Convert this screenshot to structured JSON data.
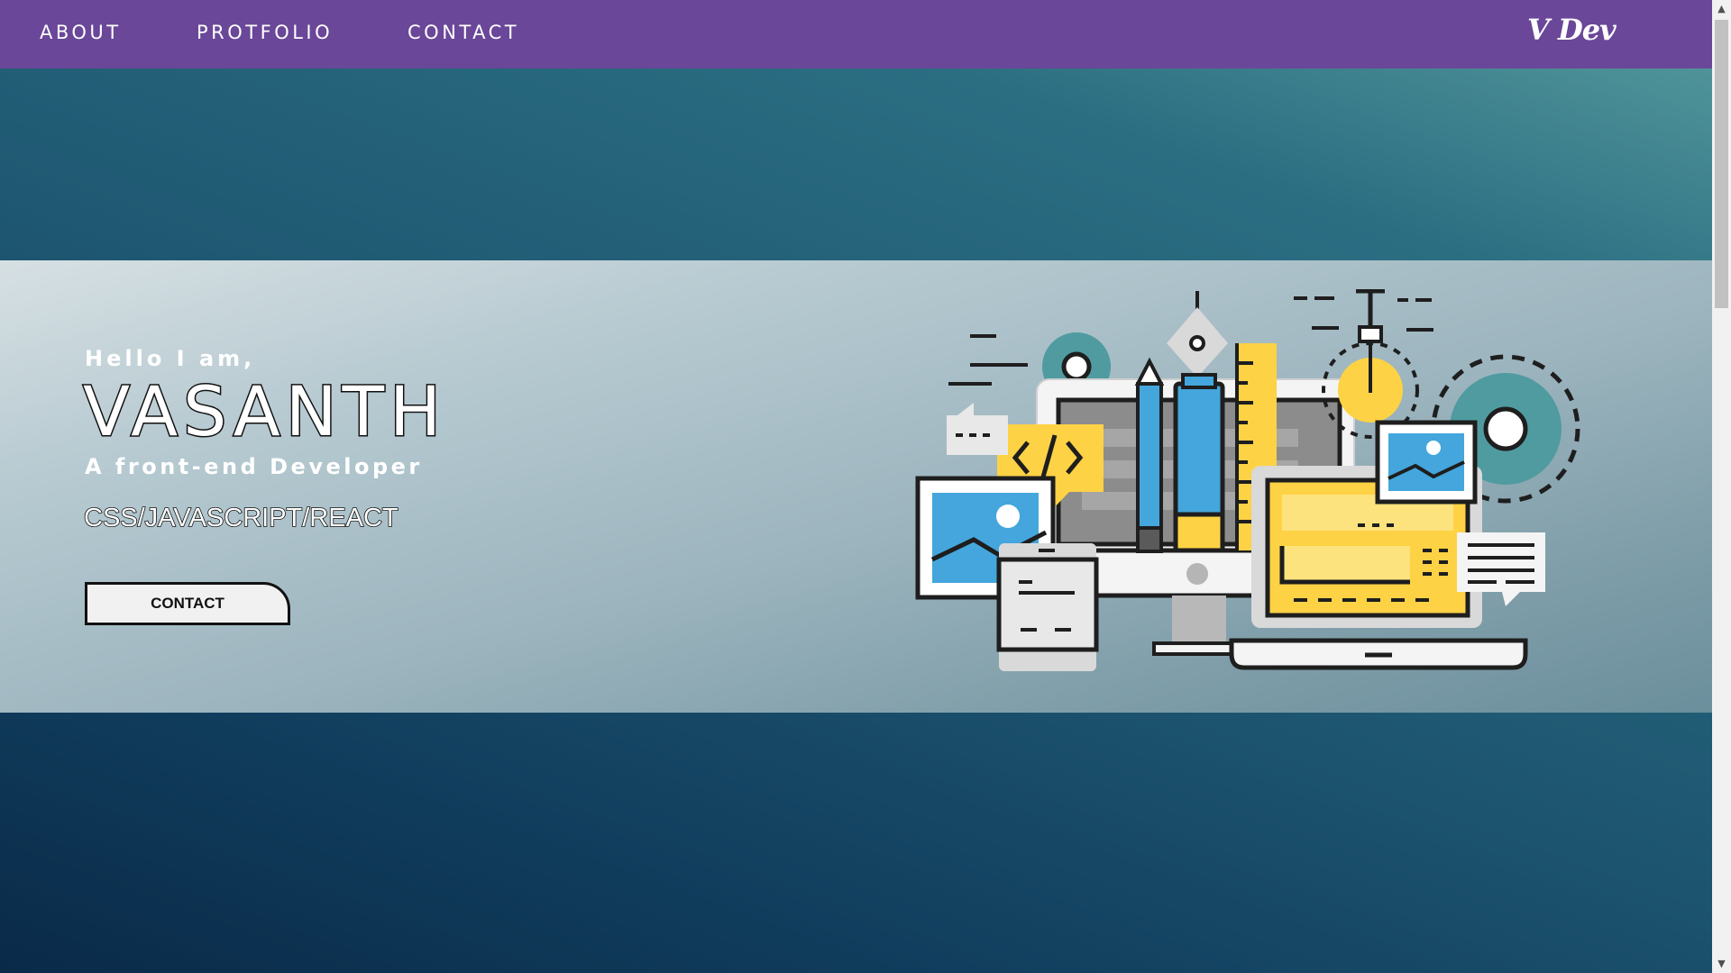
{
  "nav": {
    "about": "ABOUT",
    "portfolio": "PROTFOLIO",
    "contact": "CONTACT",
    "brand": "V Dev"
  },
  "hero": {
    "greeting": "Hello I am,",
    "name": "VASANTH",
    "role": "A front-end Developer",
    "skills": "CSS/JAVASCRIPT/REACT",
    "contact_button": "CONTACT",
    "illustration": "web-development-illustration"
  },
  "colors": {
    "navbar": "#6a4799",
    "accent_yellow": "#fdd244",
    "accent_blue": "#44a6dc",
    "gear_teal": "#4f9ba0"
  },
  "icons": {
    "scroll_up": "▲",
    "scroll_down": "▼"
  }
}
